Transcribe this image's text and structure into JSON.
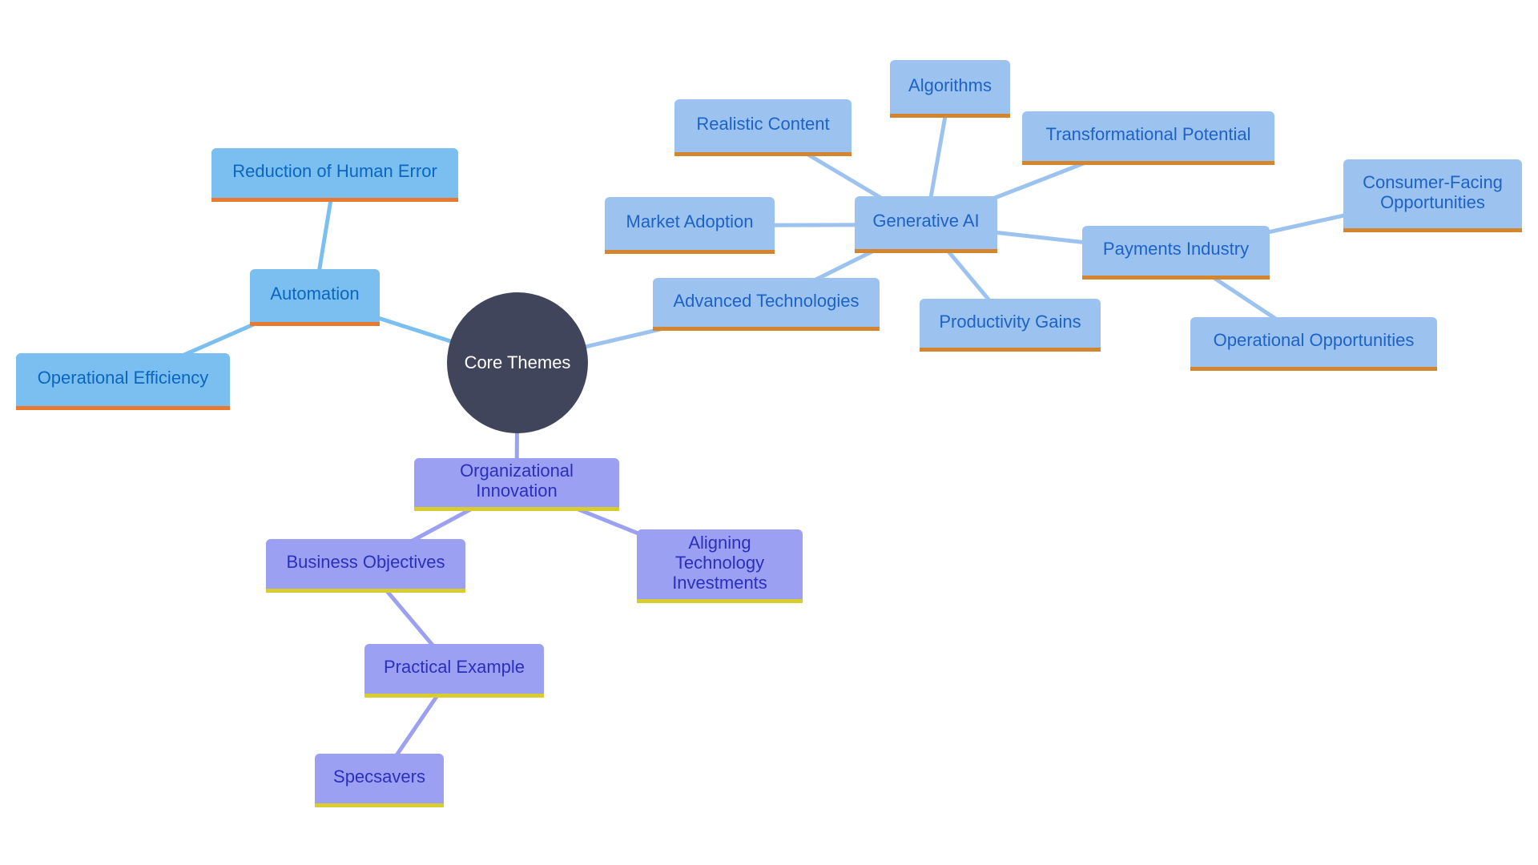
{
  "diagram": {
    "type": "mindmap",
    "root": {
      "id": "core",
      "label": "Core Themes"
    },
    "nodes": [
      {
        "id": "automation",
        "label": "Automation",
        "parent": "core",
        "family": "sky"
      },
      {
        "id": "reduction",
        "label": "Reduction of Human Error",
        "parent": "automation",
        "family": "sky"
      },
      {
        "id": "op_eff",
        "label": "Operational Efficiency",
        "parent": "automation",
        "family": "sky"
      },
      {
        "id": "adv_tech",
        "label": "Advanced Technologies",
        "parent": "core",
        "family": "blue"
      },
      {
        "id": "gen_ai",
        "label": "Generative AI",
        "parent": "adv_tech",
        "family": "blue"
      },
      {
        "id": "realistic",
        "label": "Realistic Content",
        "parent": "gen_ai",
        "family": "blue"
      },
      {
        "id": "algorithms",
        "label": "Algorithms",
        "parent": "gen_ai",
        "family": "blue"
      },
      {
        "id": "transformational",
        "label": "Transformational Potential",
        "parent": "gen_ai",
        "family": "blue"
      },
      {
        "id": "market",
        "label": "Market Adoption",
        "parent": "gen_ai",
        "family": "blue"
      },
      {
        "id": "productivity",
        "label": "Productivity Gains",
        "parent": "gen_ai",
        "family": "blue"
      },
      {
        "id": "payments",
        "label": "Payments Industry",
        "parent": "gen_ai",
        "family": "blue"
      },
      {
        "id": "consumer",
        "label": "Consumer-Facing Opportunities",
        "parent": "payments",
        "family": "blue"
      },
      {
        "id": "op_opp",
        "label": "Operational Opportunities",
        "parent": "payments",
        "family": "blue"
      },
      {
        "id": "org_inn",
        "label": "Organizational Innovation",
        "parent": "core",
        "family": "violet"
      },
      {
        "id": "aligning",
        "label": "Aligning Technology Investments",
        "parent": "org_inn",
        "family": "violet"
      },
      {
        "id": "biz_obj",
        "label": "Business Objectives",
        "parent": "org_inn",
        "family": "violet"
      },
      {
        "id": "practical",
        "label": "Practical Example",
        "parent": "biz_obj",
        "family": "violet"
      },
      {
        "id": "specsavers",
        "label": "Specsavers",
        "parent": "practical",
        "family": "violet"
      }
    ],
    "colors": {
      "root_fill": "#41455b",
      "sky_fill": "#7bbff0",
      "sky_text": "#0a66bf",
      "sky_accent": "#e8792e",
      "blue_fill": "#9cc3ef",
      "blue_text": "#1d62c6",
      "blue_accent": "#d3862e",
      "violet_fill": "#9ca0f2",
      "violet_text": "#2b2fbd",
      "violet_accent": "#d8cc2e"
    }
  }
}
